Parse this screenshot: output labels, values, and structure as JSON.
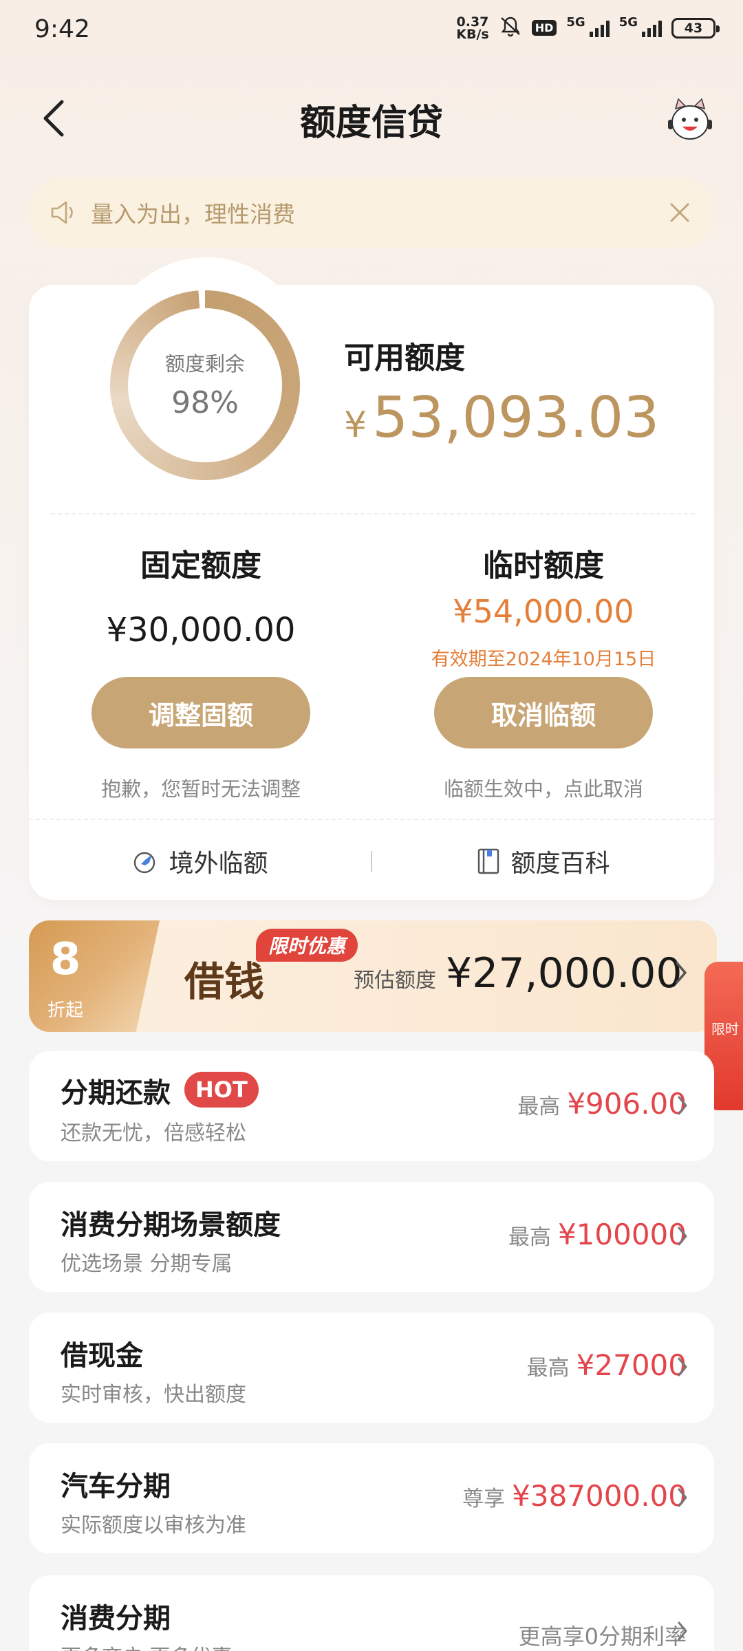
{
  "status_bar": {
    "time": "9:42",
    "net_speed_value": "0.37",
    "net_speed_unit": "KB/s",
    "hd_label": "HD",
    "network_1": "5G",
    "network_2": "5G",
    "battery": "43"
  },
  "header": {
    "title": "额度信贷"
  },
  "notice": {
    "text": "量入为出，理性消费"
  },
  "quota": {
    "ring_label": "额度剩余",
    "ring_percent": "98%",
    "ring_fraction": 0.98,
    "available_label": "可用额度",
    "available_currency": "¥",
    "available_amount": "53,093.03",
    "fixed": {
      "title": "固定额度",
      "amount": "¥30,000.00",
      "button": "调整固额",
      "hint": "抱歉，您暂时无法调整"
    },
    "temporary": {
      "title": "临时额度",
      "amount": "¥54,000.00",
      "valid": "有效期至2024年10月15日",
      "button": "取消临额",
      "hint": "临额生效中，点此取消"
    },
    "subnav": [
      {
        "label": "境外临额"
      },
      {
        "label": "额度百科"
      }
    ]
  },
  "promo": {
    "discount_num": "8",
    "discount_text": "折起",
    "loan_label": "借钱",
    "badge": "限时优惠",
    "estimate_label": "预估额度",
    "estimate_amount": "¥27,000.00",
    "side_text": "限时"
  },
  "rows": [
    {
      "title": "分期还款",
      "tag": "HOT",
      "subtitle": "还款无忧，倍感轻松",
      "prefix": "最高",
      "value": "¥906.00"
    },
    {
      "title": "消费分期场景额度",
      "subtitle": "优选场景 分期专属",
      "prefix": "最高",
      "value": "¥100000"
    },
    {
      "title": "借现金",
      "subtitle": "实时审核，快出额度",
      "prefix": "最高",
      "value": "¥27000"
    },
    {
      "title": "汽车分期",
      "subtitle": "实际额度以审核为准",
      "prefix": "尊享",
      "value": "¥387000.00"
    },
    {
      "title": "消费分期",
      "subtitle": "更多商户 更多优惠",
      "right_text": "更高享0分期利率"
    }
  ],
  "colors": {
    "gold": "#c8a574",
    "orange": "#e47f3a",
    "red": "#e4454a",
    "hot": "#e14848"
  }
}
